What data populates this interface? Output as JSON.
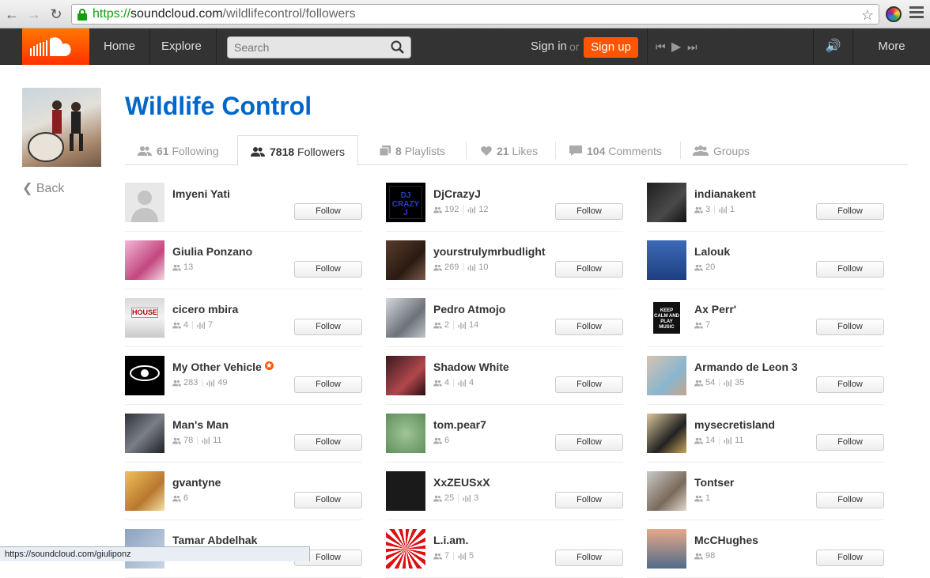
{
  "browser": {
    "url_scheme": "https://",
    "url_host": "soundcloud.com",
    "url_path": "/wildlifecontrol/followers",
    "status_url": "https://soundcloud.com/giuliponz"
  },
  "header": {
    "home": "Home",
    "explore": "Explore",
    "search_placeholder": "Search",
    "sign_in": "Sign in",
    "or": "or",
    "sign_up": "Sign up",
    "more": "More"
  },
  "profile": {
    "name": "Wildlife Control",
    "back": "Back"
  },
  "tabs": [
    {
      "count": "61",
      "label": "Following"
    },
    {
      "count": "7818",
      "label": "Followers"
    },
    {
      "count": "8",
      "label": "Playlists"
    },
    {
      "count": "21",
      "label": "Likes"
    },
    {
      "count": "104",
      "label": "Comments"
    },
    {
      "count": "",
      "label": "Groups"
    }
  ],
  "follow_label": "Follow",
  "columns": [
    [
      {
        "name": "Imyeni Yati",
        "followers": "",
        "tracks": ""
      },
      {
        "name": "Giulia Ponzano",
        "followers": "13",
        "tracks": ""
      },
      {
        "name": "cicero mbira",
        "followers": "4",
        "tracks": "7"
      },
      {
        "name": "My Other Vehicle",
        "followers": "283",
        "tracks": "49"
      },
      {
        "name": "Man's Man",
        "followers": "78",
        "tracks": "11"
      },
      {
        "name": "gvantyne",
        "followers": "6",
        "tracks": ""
      },
      {
        "name": "Tamar Abdelhak",
        "followers": "",
        "tracks": ""
      }
    ],
    [
      {
        "name": "DjCrazyJ",
        "followers": "192",
        "tracks": "12"
      },
      {
        "name": "yourstrulymrbudlight",
        "followers": "269",
        "tracks": "10"
      },
      {
        "name": "Pedro Atmojo",
        "followers": "2",
        "tracks": "14"
      },
      {
        "name": "Shadow White",
        "followers": "4",
        "tracks": "4"
      },
      {
        "name": "tom.pear7",
        "followers": "6",
        "tracks": ""
      },
      {
        "name": "XxZEUSxX",
        "followers": "25",
        "tracks": "3"
      },
      {
        "name": "L.i.am.",
        "followers": "7",
        "tracks": "5"
      }
    ],
    [
      {
        "name": "indianakent",
        "followers": "3",
        "tracks": "1"
      },
      {
        "name": "Lalouk",
        "followers": "20",
        "tracks": ""
      },
      {
        "name": "Ax Perr'",
        "followers": "7",
        "tracks": ""
      },
      {
        "name": "Armando de Leon 3",
        "followers": "54",
        "tracks": "35"
      },
      {
        "name": "mysecretisland",
        "followers": "14",
        "tracks": "11"
      },
      {
        "name": "Tontser",
        "followers": "1",
        "tracks": ""
      },
      {
        "name": "McCHughes",
        "followers": "98",
        "tracks": ""
      }
    ]
  ],
  "thumb_images": {
    "dj_text": "DJ CRAZY J",
    "keep_calm": "KEEP CALM AND PLAY MUSIC",
    "house_text": "HOUSE"
  },
  "colors": {
    "brand_orange": "#ff5500",
    "link_blue": "#0066cc",
    "header_dark": "#333333"
  }
}
